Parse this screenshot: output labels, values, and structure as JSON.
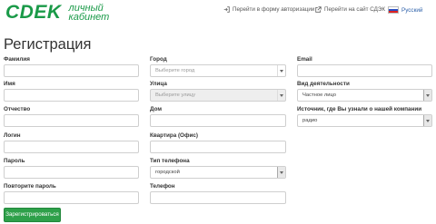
{
  "brand": {
    "logo_text": "СDEK",
    "subtitle_line1": "личный",
    "subtitle_line2": "кабинет"
  },
  "top_links": {
    "auth": "Перейти в форму авторизации",
    "site": "Перейти на сайт СДЭК",
    "language": "Русский"
  },
  "page_title": "Регистрация",
  "form": {
    "lastname_label": "Фамилия",
    "firstname_label": "Имя",
    "middlename_label": "Отчество",
    "login_label": "Логин",
    "password_label": "Пароль",
    "password_repeat_label": "Повторите пароль",
    "city_label": "Город",
    "city_placeholder": "Выберите город",
    "street_label": "Улица",
    "street_placeholder": "Выберите улицу",
    "house_label": "Дом",
    "apartment_label": "Квартира (Офис)",
    "phone_type_label": "Тип телефона",
    "phone_type_value": "городской",
    "phone_label": "Телефон",
    "email_label": "Email",
    "activity_label": "Вид деятельности",
    "activity_value": "Частное лицо",
    "source_label": "Источник, где Вы узнали о нашей компании",
    "source_value": "радио",
    "submit_label": "Зарегистрироваться"
  },
  "colors": {
    "brand_green": "#1a9a48",
    "button_green": "#2ea04a"
  }
}
